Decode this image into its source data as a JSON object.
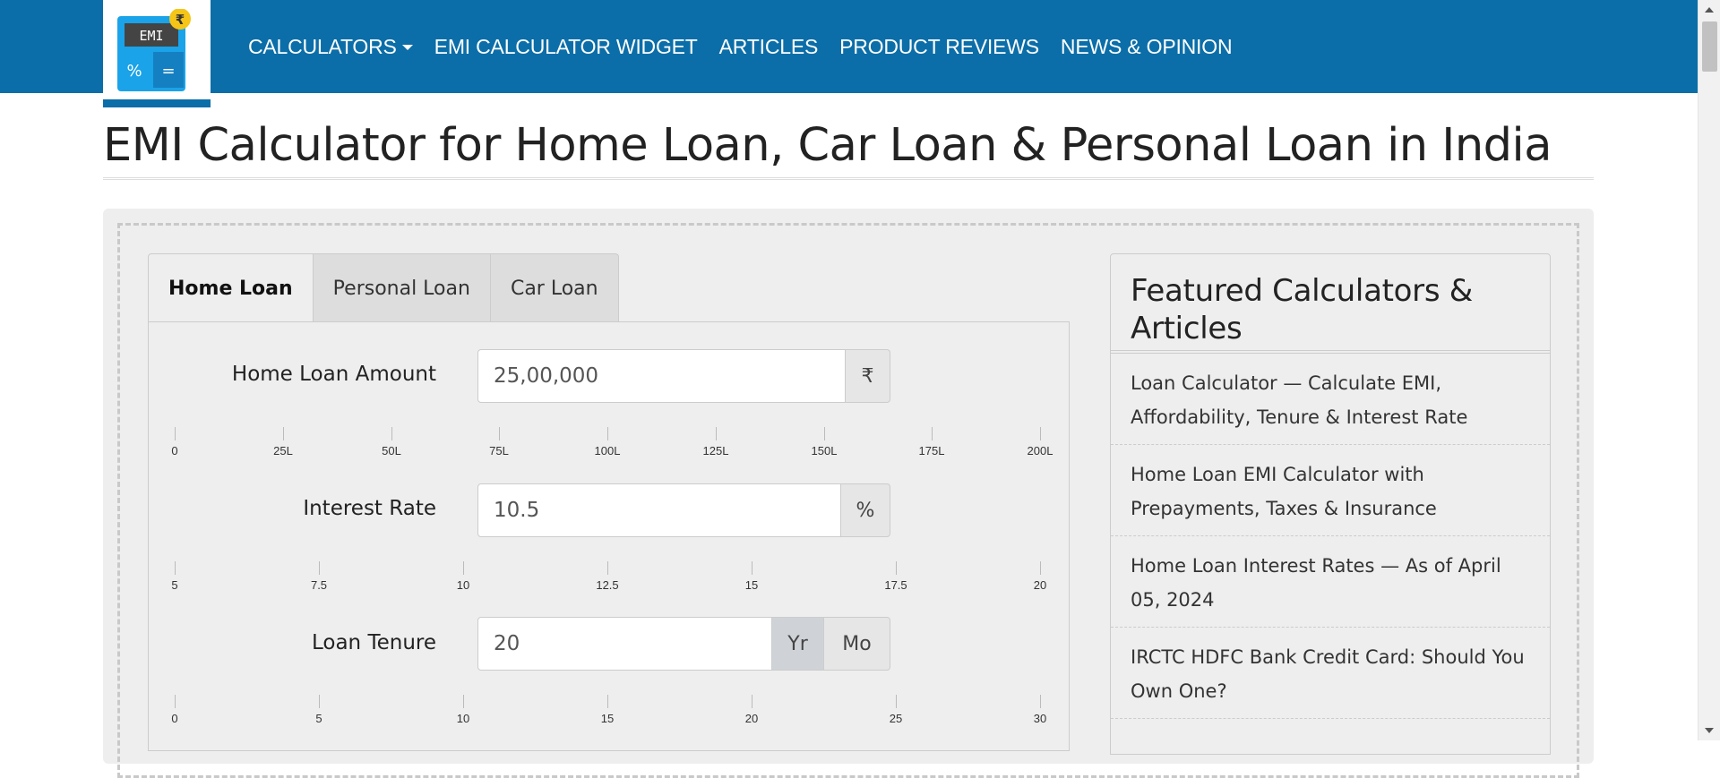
{
  "logo": {
    "screen_text": "EMI",
    "badge_symbol": "₹",
    "key_left": "%",
    "key_right": "="
  },
  "nav": {
    "items": [
      {
        "label": "CALCULATORS",
        "dropdown": true
      },
      {
        "label": "EMI CALCULATOR WIDGET"
      },
      {
        "label": "ARTICLES"
      },
      {
        "label": "PRODUCT REVIEWS"
      },
      {
        "label": "NEWS & OPINION"
      }
    ]
  },
  "page": {
    "title": "EMI Calculator for Home Loan, Car Loan & Personal Loan in India"
  },
  "tabs": [
    {
      "label": "Home Loan",
      "active": true
    },
    {
      "label": "Personal Loan",
      "active": false
    },
    {
      "label": "Car Loan",
      "active": false
    }
  ],
  "form": {
    "amount": {
      "label": "Home Loan Amount",
      "value": "25,00,000",
      "addon": "₹",
      "ticks": [
        "0",
        "25L",
        "50L",
        "75L",
        "100L",
        "125L",
        "150L",
        "175L",
        "200L"
      ]
    },
    "rate": {
      "label": "Interest Rate",
      "value": "10.5",
      "addon": "%",
      "ticks": [
        "5",
        "7.5",
        "10",
        "12.5",
        "15",
        "17.5",
        "20"
      ]
    },
    "tenure": {
      "label": "Loan Tenure",
      "value": "20",
      "unit_year": "Yr",
      "unit_month": "Mo",
      "selected_unit": "Yr",
      "ticks": [
        "0",
        "5",
        "10",
        "15",
        "20",
        "25",
        "30"
      ]
    }
  },
  "sidebar": {
    "title": "Featured Calculators & Articles",
    "items": [
      "Loan Calculator — Calculate EMI, Affordability, Tenure & Interest Rate",
      "Home Loan EMI Calculator with Prepayments, Taxes & Insurance",
      "Home Loan Interest Rates — As of April 05, 2024",
      "IRCTC HDFC Bank Credit Card: Should You Own One?"
    ]
  },
  "colors": {
    "brand": "#0b6ea8",
    "panel": "#eeeeee",
    "logo_blue": "#1aa3e8",
    "badge": "#f5c518"
  }
}
